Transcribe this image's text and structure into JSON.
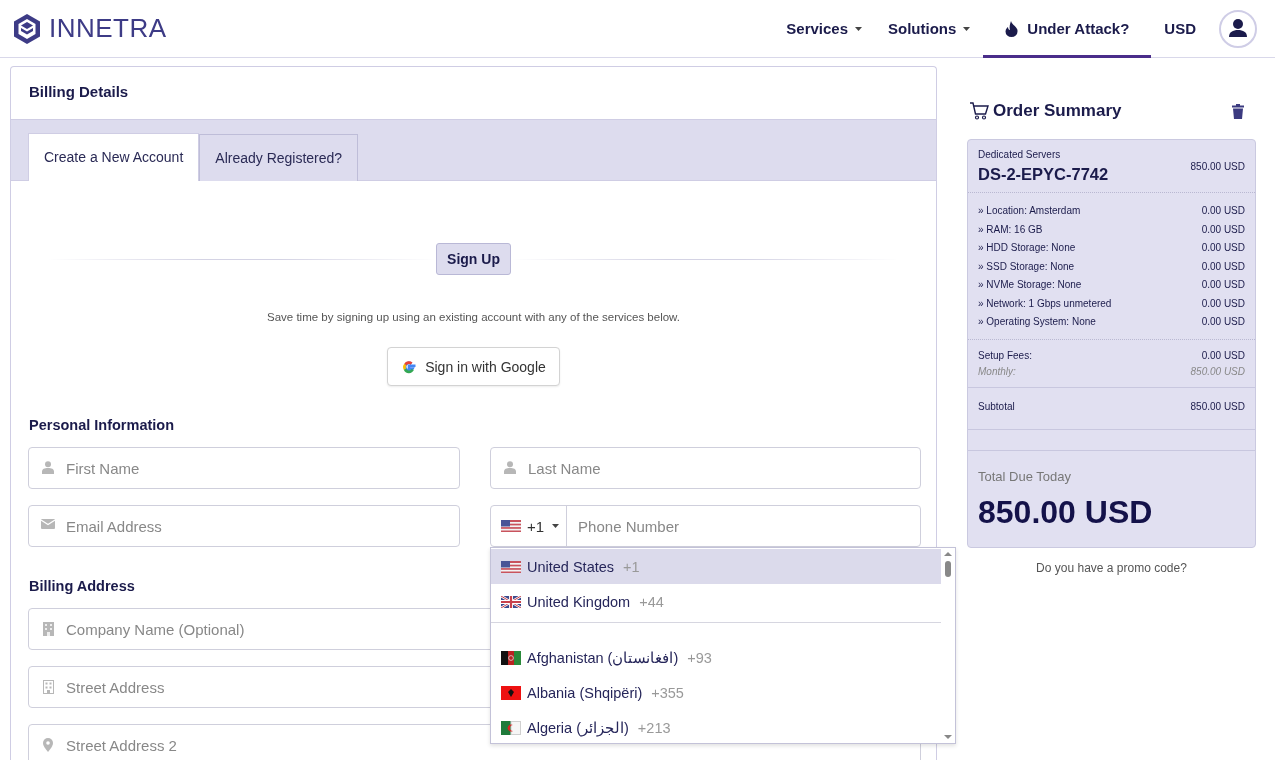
{
  "brand": {
    "name": "INNETRA"
  },
  "nav": [
    {
      "label": "Services",
      "kind": "dropdown",
      "selected": false
    },
    {
      "label": "Solutions",
      "kind": "dropdown",
      "selected": false
    },
    {
      "label": "Under Attack?",
      "kind": "alert",
      "selected": true
    },
    {
      "label": "USD",
      "kind": "plain",
      "selected": false
    }
  ],
  "billing": {
    "title": "Billing Details",
    "tabs": [
      {
        "label": "Create a New Account",
        "selected": true
      },
      {
        "label": "Already Registered?",
        "selected": false
      }
    ],
    "signup": {
      "heading": "Sign Up",
      "note": "Save time by signing up using an existing account with any of the services below.",
      "google_button": "Sign in with Google"
    },
    "sections": [
      {
        "title": "Personal Information",
        "fields": [
          {
            "kind": "person",
            "placeholder": "First Name"
          },
          {
            "kind": "person",
            "placeholder": "Last Name"
          },
          {
            "kind": "email",
            "placeholder": "Email Address"
          },
          {
            "kind": "phone",
            "placeholder": "Phone Number",
            "dial_code": "+1"
          }
        ]
      },
      {
        "title": "Billing Address",
        "fields": [
          {
            "kind": "company",
            "placeholder": "Company Name (Optional)"
          },
          {
            "kind": "street",
            "placeholder": "Street Address"
          },
          {
            "kind": "location",
            "placeholder": "Street Address 2"
          }
        ]
      }
    ],
    "country_dropdown": {
      "preferred": [
        {
          "name": "United States",
          "code": "+1",
          "selected": true
        },
        {
          "name": "United Kingdom",
          "code": "+44",
          "selected": false
        }
      ],
      "all": [
        {
          "name": "Afghanistan (افغانستان)",
          "code": "+93",
          "selected": false
        },
        {
          "name": "Albania (Shqipëri)",
          "code": "+355",
          "selected": false
        },
        {
          "name": "Algeria (الجزائر)",
          "code": "+213",
          "selected": false
        }
      ]
    }
  },
  "order_summary": {
    "title": "Order Summary",
    "category": "Dedicated Servers",
    "product": "DS-2-EPYC-7742",
    "price": "850.00 USD",
    "options": [
      {
        "label": "» Location: Amsterdam",
        "price": "0.00 USD"
      },
      {
        "label": "» RAM: 16 GB",
        "price": "0.00 USD"
      },
      {
        "label": "» HDD Storage: None",
        "price": "0.00 USD"
      },
      {
        "label": "» SSD Storage: None",
        "price": "0.00 USD"
      },
      {
        "label": "» NVMe Storage: None",
        "price": "0.00 USD"
      },
      {
        "label": "» Network: 1 Gbps unmetered",
        "price": "0.00 USD"
      },
      {
        "label": "» Operating System: None",
        "price": "0.00 USD"
      }
    ],
    "setup_fees": {
      "label": "Setup Fees:",
      "value": "0.00 USD"
    },
    "monthly": {
      "label": "Monthly:",
      "value": "850.00 USD"
    },
    "subtotal": {
      "label": "Subtotal",
      "value": "850.00 USD"
    },
    "total_label": "Total Due Today",
    "total": "850.00 USD",
    "promo_link": "Do you have a promo code?"
  }
}
